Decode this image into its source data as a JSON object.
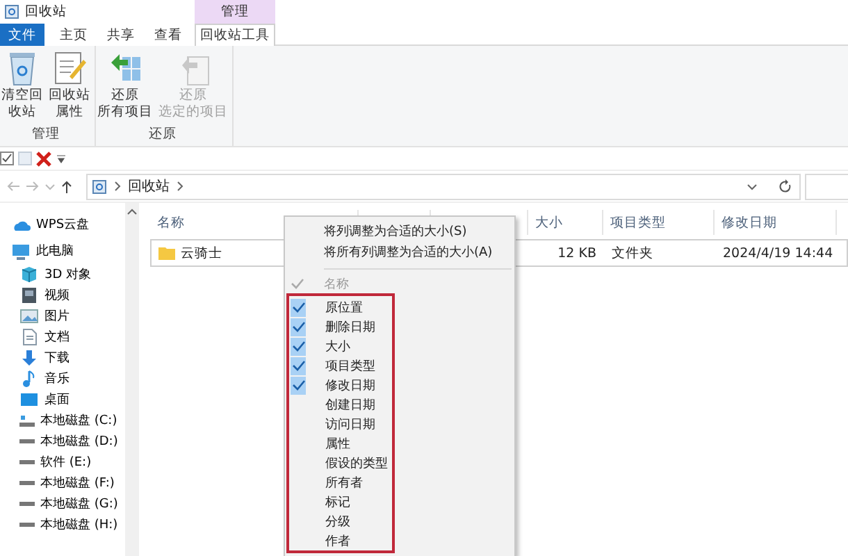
{
  "window": {
    "title": "回收站"
  },
  "ribbon_tabs": [
    {
      "label": "文件",
      "kind": "file",
      "selected": false
    },
    {
      "label": "主页",
      "kind": "normal",
      "selected": false
    },
    {
      "label": "共享",
      "kind": "normal",
      "selected": false
    },
    {
      "label": "查看",
      "kind": "normal",
      "selected": false
    },
    {
      "label": "回收站工具",
      "kind": "contextual",
      "selected": true
    }
  ],
  "contextual_header": "管理",
  "ribbon_groups": [
    {
      "label": "管理",
      "buttons": [
        {
          "lines": [
            "清空回",
            "收站"
          ],
          "disabled": false
        },
        {
          "lines": [
            "回收站",
            "属性"
          ],
          "disabled": false
        }
      ]
    },
    {
      "label": "还原",
      "buttons": [
        {
          "lines": [
            "还原",
            "所有项目"
          ],
          "disabled": false
        },
        {
          "lines": [
            "还原",
            "选定的项目"
          ],
          "disabled": true
        }
      ]
    }
  ],
  "address_bar": {
    "path": [
      "回收站"
    ]
  },
  "navigation_pane": [
    {
      "label": "WPS云盘"
    },
    {
      "label": "此电脑",
      "children": [
        {
          "label": "3D 对象"
        },
        {
          "label": "视频"
        },
        {
          "label": "图片"
        },
        {
          "label": "文档"
        },
        {
          "label": "下载"
        },
        {
          "label": "音乐"
        },
        {
          "label": "桌面"
        },
        {
          "label": "本地磁盘 (C:)"
        },
        {
          "label": "本地磁盘 (D:)"
        },
        {
          "label": "软件 (E:)"
        },
        {
          "label": "本地磁盘 (F:)"
        },
        {
          "label": "本地磁盘 (G:)"
        },
        {
          "label": "本地磁盘 (H:)"
        }
      ]
    }
  ],
  "file_list": {
    "columns": [
      "名称",
      "大小",
      "项目类型",
      "修改日期"
    ],
    "rows": [
      {
        "cells": [
          "云骑士",
          "12 KB",
          "文件夹",
          "2024/4/19 14:44"
        ],
        "selected": true
      }
    ]
  },
  "context_menu": {
    "commands": [
      "将列调整为合适的大小(S)",
      "将所有列调整为合适的大小(A)"
    ],
    "column_items": [
      {
        "label": "名称",
        "checked": true,
        "disabled": true
      }
    ],
    "highlighted_column_items": [
      {
        "label": "原位置",
        "checked": true,
        "disabled": false
      },
      {
        "label": "删除日期",
        "checked": true,
        "disabled": false
      },
      {
        "label": "大小",
        "checked": true,
        "disabled": false
      },
      {
        "label": "项目类型",
        "checked": true,
        "disabled": false
      },
      {
        "label": "修改日期",
        "checked": true,
        "disabled": false
      },
      {
        "label": "创建日期",
        "checked": false,
        "disabled": false
      },
      {
        "label": "访问日期",
        "checked": false,
        "disabled": false
      },
      {
        "label": "属性",
        "checked": false,
        "disabled": false
      },
      {
        "label": "假设的类型",
        "checked": false,
        "disabled": false
      },
      {
        "label": "所有者",
        "checked": false,
        "disabled": false
      },
      {
        "label": "标记",
        "checked": false,
        "disabled": false
      },
      {
        "label": "分级",
        "checked": false,
        "disabled": false
      },
      {
        "label": "作者",
        "checked": false,
        "disabled": false
      }
    ]
  }
}
